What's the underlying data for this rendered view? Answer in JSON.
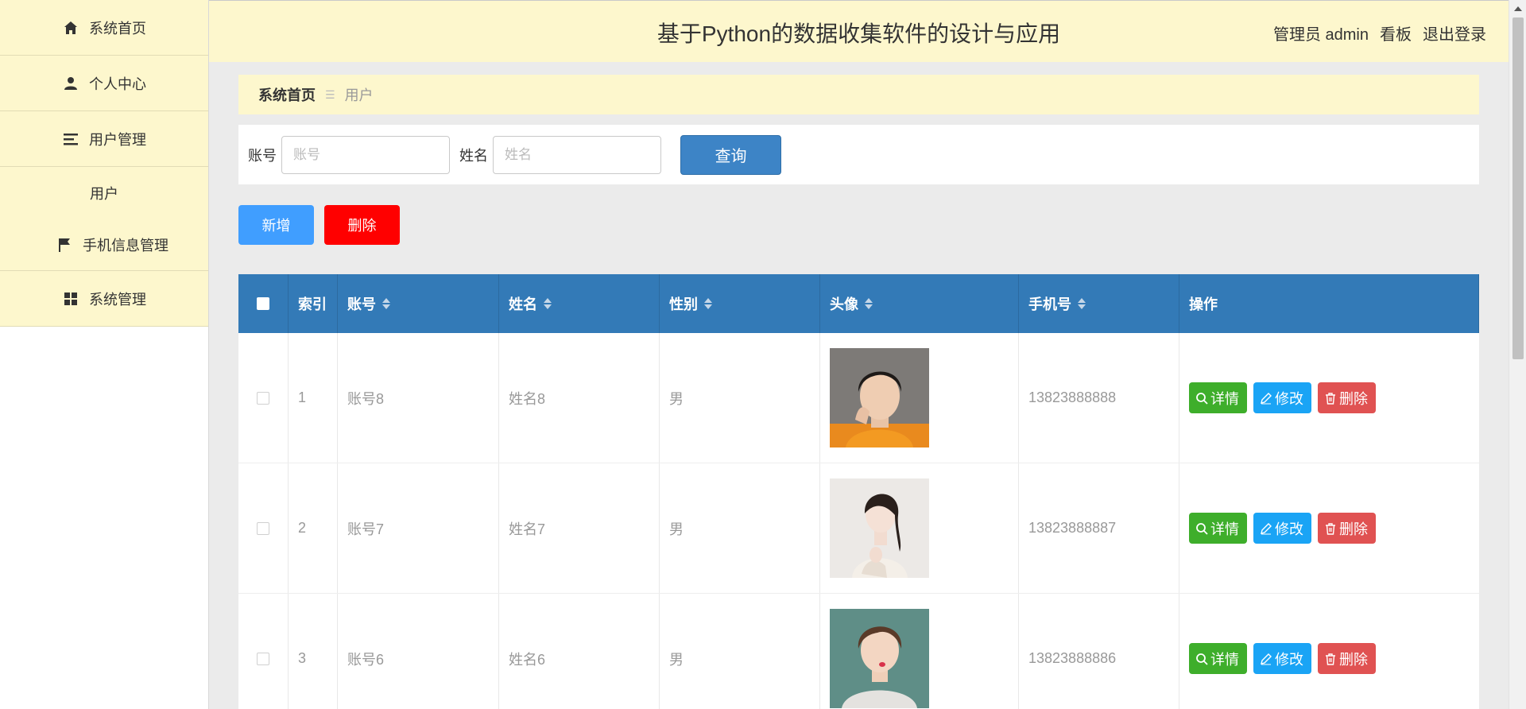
{
  "sidebar": {
    "items": [
      {
        "label": "系统首页",
        "icon": "home-icon"
      },
      {
        "label": "个人中心",
        "icon": "user-icon"
      },
      {
        "label": "用户管理",
        "icon": "list-icon"
      },
      {
        "label": "用户"
      },
      {
        "label": "手机信息管理",
        "icon": "flag-icon"
      },
      {
        "label": "系统管理",
        "icon": "grid-icon"
      }
    ]
  },
  "header": {
    "title": "基于Python的数据收集软件的设计与应用",
    "role": "管理员 admin",
    "dashboard": "看板",
    "logout": "退出登录"
  },
  "breadcrumb": {
    "home": "系统首页",
    "separator": "☰",
    "current": "用户"
  },
  "search": {
    "account_label": "账号",
    "account_placeholder": "账号",
    "name_label": "姓名",
    "name_placeholder": "姓名",
    "query": "查询"
  },
  "actions": {
    "add": "新增",
    "delete": "删除"
  },
  "table": {
    "headers": [
      "索引",
      "账号",
      "姓名",
      "性别",
      "头像",
      "手机号",
      "操作"
    ],
    "rows": [
      {
        "index": "1",
        "account": "账号8",
        "name": "姓名8",
        "gender": "男",
        "phone": "13823888888"
      },
      {
        "index": "2",
        "account": "账号7",
        "name": "姓名7",
        "gender": "男",
        "phone": "13823888887"
      },
      {
        "index": "3",
        "account": "账号6",
        "name": "姓名6",
        "gender": "男",
        "phone": "13823888886"
      }
    ],
    "ops": {
      "detail": "详情",
      "edit": "修改",
      "remove": "删除"
    }
  },
  "colors": {
    "sidebar_bg": "#fdf7cd",
    "table_header": "#337ab7",
    "detail": "#3eae2b",
    "edit": "#1aa4f5",
    "remove": "#e05252",
    "add": "#409eff",
    "delete": "#ff0000"
  }
}
